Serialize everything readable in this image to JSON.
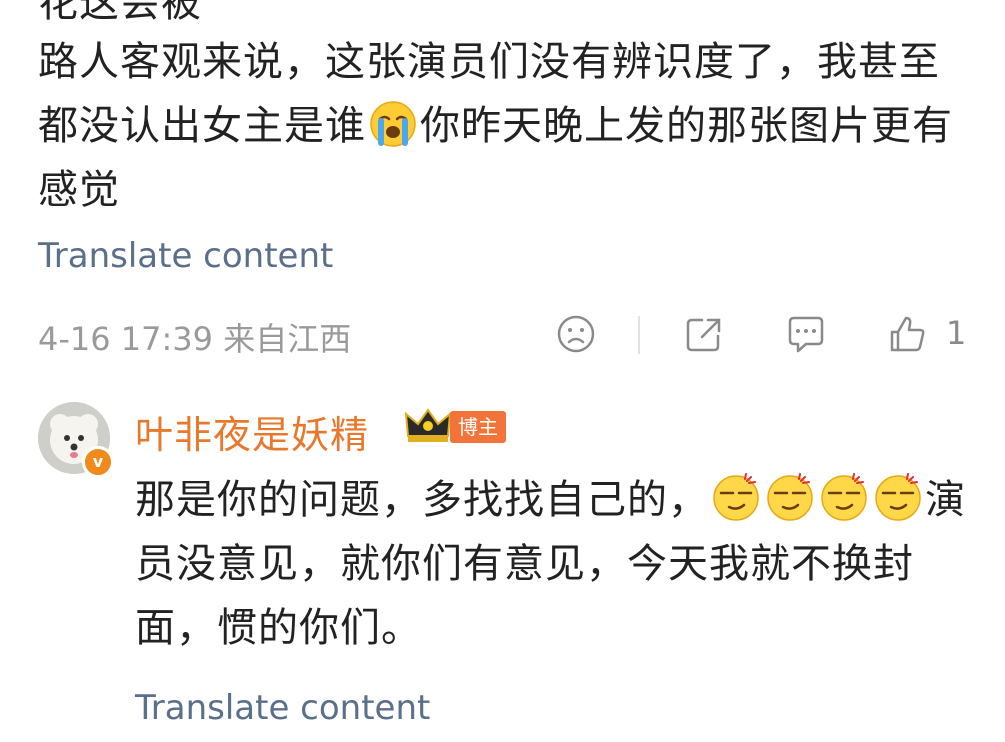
{
  "top_partial_text": "花这会被",
  "comment": {
    "text_part1": "路人客观来说，这张演员们没有辨识度了，我甚至都没认出女主是谁",
    "emoji_cry": "crying-face-emoji",
    "text_part2": "你昨天晚上发的那张图片更有感觉",
    "translate_label": "Translate content",
    "timestamp": "4-16 17:39 来自江西",
    "like_count": "1"
  },
  "reply": {
    "author": "叶非夜是妖精",
    "badge_label": "博主",
    "text_part1": "那是你的问题，多找找自己的，",
    "emoji": "smirk-face-emoji",
    "text_part2": "演员没意见，就你们有意见，今天我就不换封面，惯的你们。",
    "translate_label": "Translate content"
  },
  "colors": {
    "name": "#e8782c",
    "link": "#5a6f8a",
    "meta": "#9a9a9a",
    "badge": "#f3743a"
  }
}
